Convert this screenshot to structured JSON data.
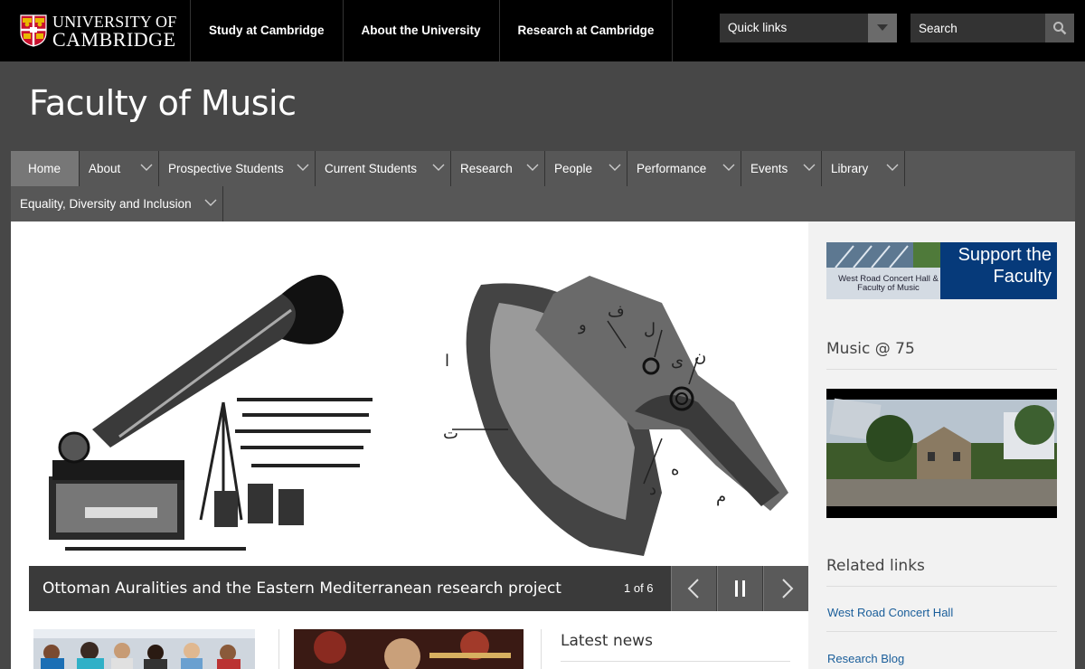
{
  "header": {
    "logo": {
      "line1": "UNIVERSITY OF",
      "line2": "CAMBRIDGE"
    },
    "nav": [
      "Study at Cambridge",
      "About the University",
      "Research at Cambridge"
    ],
    "quick_links": "Quick links",
    "search_placeholder": "Search"
  },
  "site_title": "Faculty of Music",
  "main_nav": {
    "row1": [
      {
        "label": "Home",
        "active": true
      },
      {
        "label": "About"
      },
      {
        "label": "Prospective Students"
      },
      {
        "label": "Current Students"
      },
      {
        "label": "Research"
      },
      {
        "label": "People"
      },
      {
        "label": "Performance"
      },
      {
        "label": "Events"
      },
      {
        "label": "Library"
      }
    ],
    "row2": [
      {
        "label": "Equality, Diversity and Inclusion"
      }
    ]
  },
  "carousel": {
    "caption": "Ottoman Auralities and the Eastern Mediterranean research project",
    "counter": "1 of 6"
  },
  "latest_news": "Latest news",
  "sidebar": {
    "support_title": "Support the Faculty",
    "support_sub": "West Road Concert Hall & Faculty of Music",
    "music75": "Music @ 75",
    "related_links": "Related links",
    "links": [
      "West Road Concert Hall",
      "Research Blog"
    ]
  },
  "colors": {
    "header_bg": "#000000",
    "site_bg": "#474747",
    "nav_bg": "#575757",
    "nav_active": "#777777",
    "link": "#1a5e9a",
    "support_blue": "#063a7a"
  }
}
